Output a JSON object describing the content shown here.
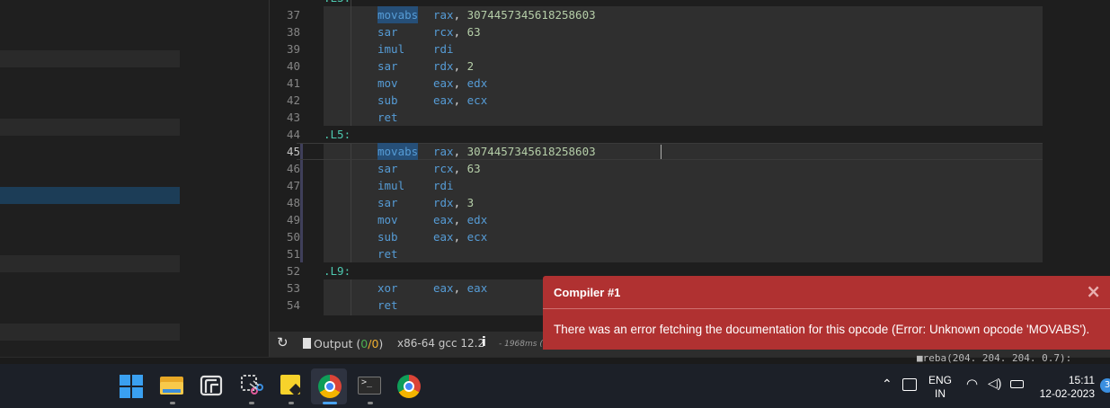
{
  "editor": {
    "lines": [
      {
        "num": "37",
        "indent": true,
        "op": "movabs",
        "a1": "rax",
        "a2": "3074457345618258603"
      },
      {
        "num": "38",
        "indent": true,
        "op": "sar",
        "a1": "rcx",
        "a2": "63"
      },
      {
        "num": "39",
        "indent": true,
        "op": "imul",
        "a1": "rdi",
        "a2": ""
      },
      {
        "num": "40",
        "indent": true,
        "op": "sar",
        "a1": "rdx",
        "a2": "2"
      },
      {
        "num": "41",
        "indent": true,
        "op": "mov",
        "a1": "eax",
        "a2": "edx"
      },
      {
        "num": "42",
        "indent": true,
        "op": "sub",
        "a1": "eax",
        "a2": "ecx"
      },
      {
        "num": "43",
        "indent": true,
        "op": "ret",
        "a1": "",
        "a2": ""
      },
      {
        "num": "44",
        "label": ".L5:"
      },
      {
        "num": "45",
        "indent": true,
        "op": "movabs",
        "a1": "rax",
        "a2": "3074457345618258603"
      },
      {
        "num": "46",
        "indent": true,
        "op": "sar",
        "a1": "rcx",
        "a2": "63"
      },
      {
        "num": "47",
        "indent": true,
        "op": "imul",
        "a1": "rdi",
        "a2": ""
      },
      {
        "num": "48",
        "indent": true,
        "op": "sar",
        "a1": "rdx",
        "a2": "3"
      },
      {
        "num": "49",
        "indent": true,
        "op": "mov",
        "a1": "eax",
        "a2": "edx"
      },
      {
        "num": "50",
        "indent": true,
        "op": "sub",
        "a1": "eax",
        "a2": "ecx"
      },
      {
        "num": "51",
        "indent": true,
        "op": "ret",
        "a1": "",
        "a2": ""
      },
      {
        "num": "52",
        "label": ".L9:"
      },
      {
        "num": "53",
        "indent": true,
        "op": "xor",
        "a1": "eax",
        "a2": "eax"
      },
      {
        "num": "54",
        "indent": true,
        "op": "ret",
        "a1": "",
        "a2": ""
      }
    ],
    "active_line": "45"
  },
  "statusbar": {
    "output_label": "Output (",
    "output_zero": "0",
    "output_slash": "/",
    "output_errors": "0",
    "output_close": ")",
    "compiler": "x86-64 gcc 12.2",
    "info": "i",
    "timing": "- 1968ms ("
  },
  "terminal_fragment": "■reba(204. 204. 204. 0.7):",
  "toast": {
    "title": "Compiler #1",
    "close": "×",
    "message": "There was an error fetching the documentation for this opcode (Error: Unknown opcode 'MOVABS')."
  },
  "taskbar": {
    "lang_top": "ENG",
    "lang_bottom": "IN",
    "time": "15:11",
    "date": "12-02-2023",
    "badge": "3"
  },
  "colors": {
    "toast_bg": "#b03131",
    "label": "#4ec9b0",
    "keyword": "#569cd6",
    "number": "#b5cea8"
  }
}
